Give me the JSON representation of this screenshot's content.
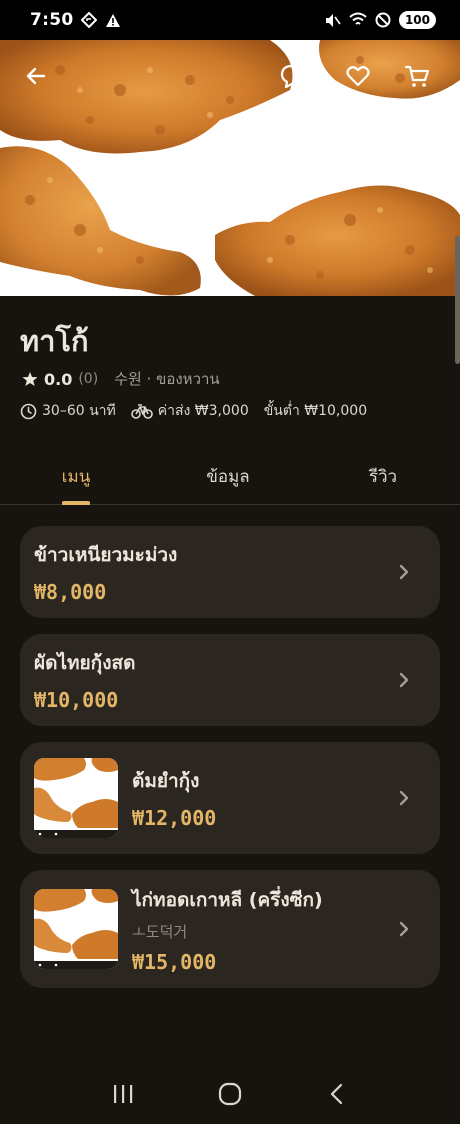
{
  "status_bar": {
    "time": "7:50",
    "battery": "100"
  },
  "hero": {
    "image": "fried-chicken-photo"
  },
  "store": {
    "name": "ทาโก้",
    "rating": "0.0",
    "rating_count": "(0)",
    "meta": "수원 · ของหวาน",
    "delivery_time": "30–60 นาที",
    "delivery_fee": "ค่าส่ง ₩3,000",
    "min_order": "ขั้นต่ำ ₩10,000"
  },
  "tabs": [
    {
      "label": "เมนู",
      "active": true
    },
    {
      "label": "ข้อมูล",
      "active": false
    },
    {
      "label": "รีวิว",
      "active": false
    }
  ],
  "menu": [
    {
      "name": "ข้าวเหนียวมะม่วง",
      "price": "₩8,000",
      "subtitle": "",
      "has_image": false
    },
    {
      "name": "ผัดไทยกุ้งสด",
      "price": "₩10,000",
      "subtitle": "",
      "has_image": false
    },
    {
      "name": "ต้มยำกุ้ง",
      "price": "₩12,000",
      "subtitle": "",
      "has_image": true
    },
    {
      "name": "ไก่ทอดเกาหลี (ครึ่งซีก)",
      "price": "₩15,000",
      "subtitle": "ㅗ도덕거",
      "has_image": true
    }
  ],
  "colors": {
    "background": "#17140f",
    "card": "#2b2720",
    "accent": "#e3b566",
    "text": "#ece6dc",
    "muted": "#8f887d"
  }
}
